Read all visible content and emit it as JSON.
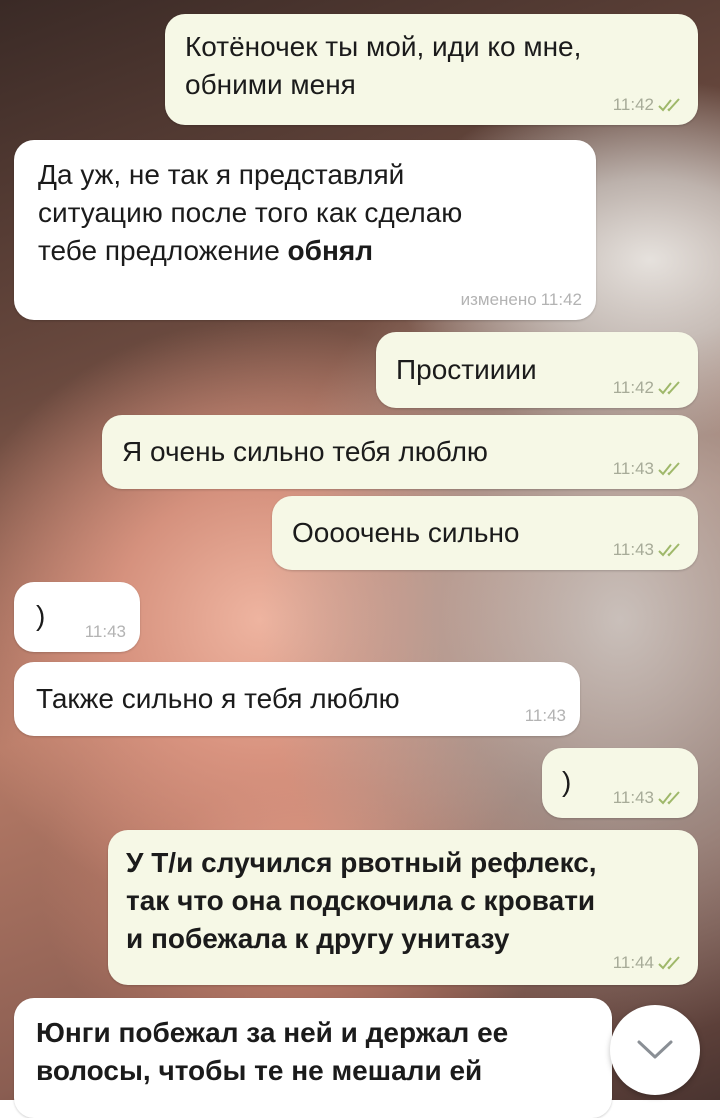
{
  "messages": [
    {
      "direction": "out",
      "text": "Котёночек ты мой, иди ко мне,\nобними меня",
      "time": "11:42",
      "read": true
    },
    {
      "direction": "in",
      "text": "Да уж, не так я представляй\nситуацию после того как сделаю\nтебе предложение",
      "emphasis": "обнял",
      "edited_label": "изменено",
      "time": "11:42"
    },
    {
      "direction": "out",
      "text": "Простииии",
      "time": "11:42",
      "read": true
    },
    {
      "direction": "out",
      "text": "Я очень сильно тебя люблю",
      "time": "11:43",
      "read": true
    },
    {
      "direction": "out",
      "text": "Оооочень сильно",
      "time": "11:43",
      "read": true
    },
    {
      "direction": "in",
      "text": ")",
      "time": "11:43"
    },
    {
      "direction": "in",
      "text": "Также сильно я тебя люблю",
      "time": "11:43"
    },
    {
      "direction": "out",
      "text": ")",
      "time": "11:43",
      "read": true
    },
    {
      "direction": "out",
      "text": "У Т/и случился рвотный рефлекс,\nтак что она подскочила с кровати\nи побежала к другу унитазу",
      "time": "11:44",
      "read": true,
      "bold": true
    },
    {
      "direction": "in",
      "text": "Юнги побежал за ней и держал ее\nволосы, чтобы те не мешали ей",
      "bold": true
    }
  ],
  "icons": {
    "read_receipt": "double-check-icon",
    "scroll_down": "chevron-down-icon"
  },
  "colors": {
    "incoming_bubble": "#ffffff",
    "outgoing_bubble": "#f6f8e6",
    "timestamp_outgoing": "#a7ab98",
    "timestamp_incoming": "#b3b3b3",
    "read_check": "#9fb86a"
  }
}
